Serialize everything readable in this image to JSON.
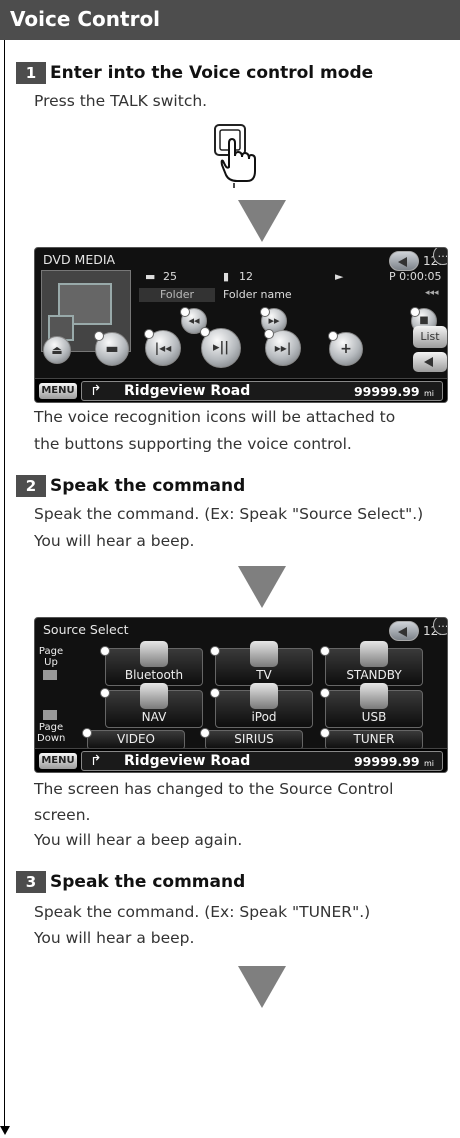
{
  "header": {
    "title": "Voice Control"
  },
  "steps": [
    {
      "num": "1",
      "title": "Enter into the Voice control mode",
      "text1": "Press the TALK switch."
    },
    {
      "num": "2",
      "title": "Speak the command",
      "text1": "Speak the command. (Ex: Speak \"Source Select\".)",
      "text2": "You will hear a beep."
    },
    {
      "num": "3",
      "title": "Speak the command",
      "text1": "Speak the command. (Ex: Speak \"TUNER\".)",
      "text2": "You will hear a beep."
    }
  ],
  "after1": {
    "line1": "The voice recognition icons will be attached to",
    "line2": "the buttons supporting the voice control."
  },
  "after2": {
    "line1": "The screen has changed to the Source Control",
    "line2": "screen.",
    "line3": "You will hear a beep again."
  },
  "screen1": {
    "title": "DVD MEDIA",
    "clock": "12:",
    "folder_count": "25",
    "file_count": "12",
    "play_time": "P  0:00:05",
    "folder_label": "Folder",
    "folder_name": "Folder name",
    "list_label": "List"
  },
  "screen2": {
    "title": "Source Select",
    "clock": "12:",
    "page_up": "Page Up",
    "page_down": "Page Down",
    "sources": [
      "Bluetooth",
      "TV",
      "STANDBY",
      "NAV",
      "iPod",
      "USB",
      "VIDEO",
      "SIRIUS",
      "TUNER"
    ]
  },
  "statusbar": {
    "menu": "MENU",
    "road": "Ridgeview Road",
    "distance": "99999.99",
    "unit": "mi"
  }
}
